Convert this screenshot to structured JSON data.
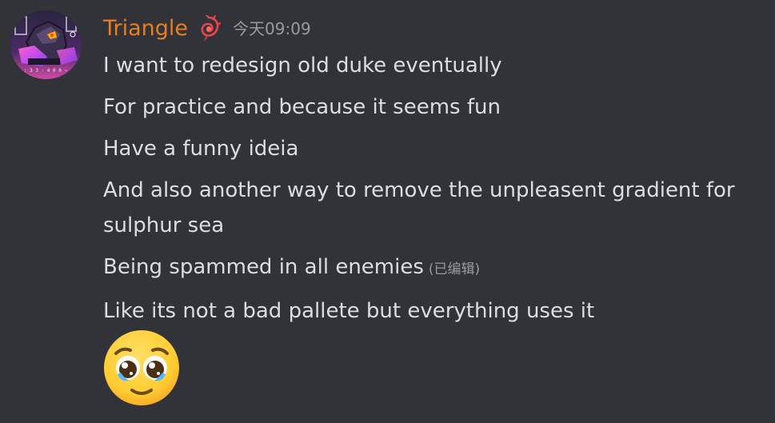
{
  "author": {
    "username": "Triangle",
    "username_color": "#e67e22",
    "avatar_icon": "robot-avatar",
    "role_icon": "red-spiral-icon"
  },
  "timestamp": "今天09:09",
  "messages": [
    {
      "text": "I want to redesign old duke eventually"
    },
    {
      "text": "For practice and because it seems fun"
    },
    {
      "text": "Have a funny ideia"
    },
    {
      "text": "And also another way to remove the unpleasent gradient for sulphur sea"
    },
    {
      "text": "Being spammed in all enemies",
      "edited_label": "(已编辑)"
    },
    {
      "text": "Like its not a bad pallete but everything uses it"
    }
  ],
  "emoji": {
    "name": "pleading-face-emoji"
  },
  "colors": {
    "background": "#313338",
    "text": "#dbdee1",
    "muted": "#949ba4"
  }
}
